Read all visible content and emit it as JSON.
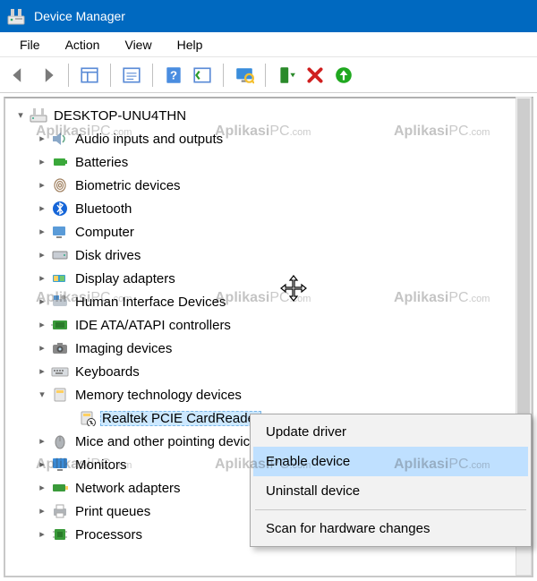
{
  "window": {
    "title": "Device Manager"
  },
  "menu": {
    "file": "File",
    "action": "Action",
    "view": "View",
    "help": "Help"
  },
  "tree": {
    "root": "DESKTOP-UNU4THN",
    "items": [
      {
        "label": "Audio inputs and outputs"
      },
      {
        "label": "Batteries"
      },
      {
        "label": "Biometric devices"
      },
      {
        "label": "Bluetooth"
      },
      {
        "label": "Computer"
      },
      {
        "label": "Disk drives"
      },
      {
        "label": "Display adapters"
      },
      {
        "label": "Human Interface Devices"
      },
      {
        "label": "IDE ATA/ATAPI controllers"
      },
      {
        "label": "Imaging devices"
      },
      {
        "label": "Keyboards"
      },
      {
        "label": "Memory technology devices"
      },
      {
        "label": "Realtek PCIE CardReader"
      },
      {
        "label": "Mice and other pointing devices"
      },
      {
        "label": "Monitors"
      },
      {
        "label": "Network adapters"
      },
      {
        "label": "Print queues"
      },
      {
        "label": "Processors"
      }
    ]
  },
  "context_menu": {
    "update": "Update driver",
    "enable": "Enable device",
    "uninstall": "Uninstall device",
    "scan": "Scan for hardware changes"
  },
  "watermark": "AplikasiPC.com"
}
